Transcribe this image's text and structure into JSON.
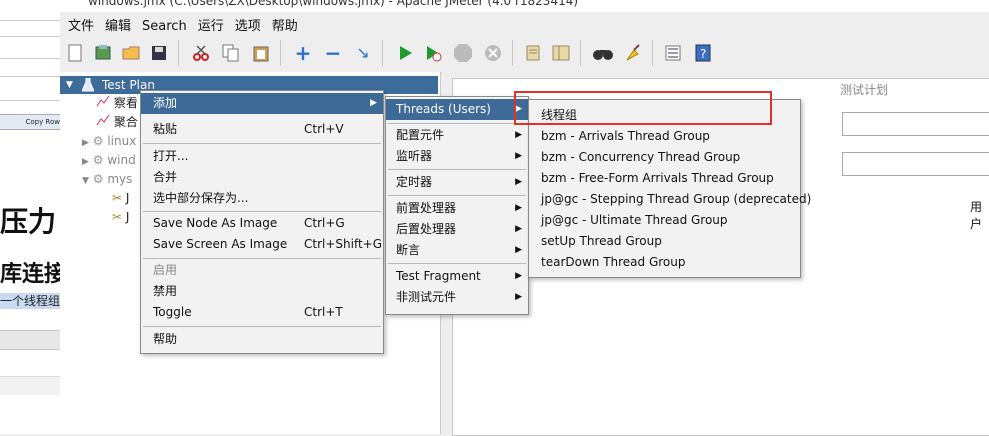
{
  "bg_app": {
    "copy_row_label": "Copy Row",
    "text_big1": "压力",
    "text_big2": "库连接",
    "text_hl": "一个线程组"
  },
  "window": {
    "title": "windows.jmx (C:\\Users\\ZX\\Desktop\\windows.jmx) - Apache JMeter (4.0 r1823414)"
  },
  "menubar": [
    "文件",
    "编辑",
    "Search",
    "运行",
    "选项",
    "帮助"
  ],
  "tree": {
    "root": "Test Plan",
    "items": [
      "察看",
      "聚合",
      "linux",
      "wind",
      "mys",
      "J",
      "J"
    ]
  },
  "right_panel": {
    "faint_text": "测试计划",
    "partial_label": "用户"
  },
  "menu1": {
    "items": [
      {
        "label": "添加",
        "shortcut": "",
        "submenu": true,
        "selected": true
      },
      {
        "label": "粘贴",
        "shortcut": "Ctrl+V"
      },
      {
        "label": "打开...",
        "shortcut": ""
      },
      {
        "label": "合并",
        "shortcut": ""
      },
      {
        "label": "选中部分保存为...",
        "shortcut": ""
      },
      {
        "label": "Save Node As Image",
        "shortcut": "Ctrl+G"
      },
      {
        "label": "Save Screen As Image",
        "shortcut": "Ctrl+Shift+G"
      },
      {
        "label": "启用",
        "shortcut": "",
        "disabled": true
      },
      {
        "label": "禁用",
        "shortcut": ""
      },
      {
        "label": "Toggle",
        "shortcut": "Ctrl+T"
      },
      {
        "label": "帮助",
        "shortcut": ""
      }
    ]
  },
  "menu2": {
    "items": [
      {
        "label": "Threads (Users)",
        "selected": true
      },
      {
        "label": "配置元件"
      },
      {
        "label": "监听器"
      },
      {
        "label": "定时器"
      },
      {
        "label": "前置处理器"
      },
      {
        "label": "后置处理器"
      },
      {
        "label": "断言"
      },
      {
        "label": "Test Fragment"
      },
      {
        "label": "非测试元件"
      }
    ]
  },
  "menu3": {
    "items": [
      "线程组",
      "bzm - Arrivals Thread Group",
      "bzm - Concurrency Thread Group",
      "bzm - Free-Form Arrivals Thread Group",
      "jp@gc - Stepping Thread Group (deprecated)",
      "jp@gc - Ultimate Thread Group",
      "setUp Thread Group",
      "tearDown Thread Group"
    ]
  },
  "colors": {
    "selection": "#3d6a97",
    "highlight_box": "#e5302a"
  }
}
